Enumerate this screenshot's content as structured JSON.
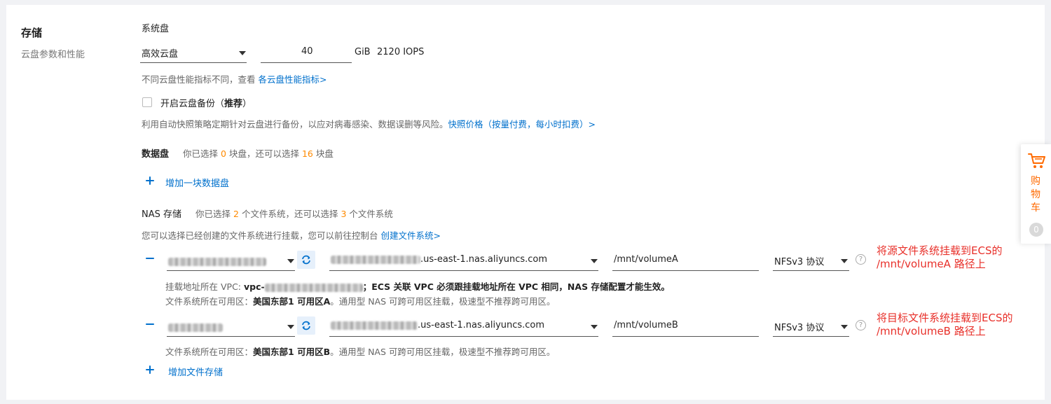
{
  "section": {
    "title": "存储",
    "subtitle": "云盘参数和性能"
  },
  "system_disk": {
    "label": "系统盘",
    "type_value": "高效云盘",
    "size_value": "40",
    "unit": "GiB",
    "iops": "2120 IOPS",
    "perf_note": "不同云盘性能指标不同，查看",
    "perf_link": "各云盘性能指标>",
    "backup_label": "开启云盘备份（",
    "backup_bold": "推荐",
    "backup_close": "）",
    "backup_desc": "利用自动快照策略定期针对云盘进行备份，以应对病毒感染、数据误删等风险。",
    "snapshot_link": "快照价格（按量付费，每小时扣费）>"
  },
  "data_disk": {
    "label": "数据盘",
    "status_pre": "你已选择",
    "selected": "0",
    "status_mid": "块盘，还可以选择",
    "remaining": "16",
    "status_post": "块盘",
    "add_label": "增加一块数据盘"
  },
  "nas": {
    "label": "NAS 存储",
    "status_pre": "你已选择",
    "selected": "2",
    "status_mid": "个文件系统，还可以选择",
    "remaining": "3",
    "status_post": "个文件系统",
    "note": "您可以选择已经创建的文件系统进行挂载，您可以前往控制台",
    "create_link": "创建文件系统>",
    "add_label": "增加文件存储",
    "mounts": [
      {
        "mount_suffix": ".us-east-1.nas.aliyuncs.com",
        "path": "/mnt/volumeA",
        "protocol": "NFSv3 协议",
        "vpc_label": "挂载地址所在 VPC:",
        "vpc_prefix": "vpc-",
        "vpc_note": "；ECS 关联 VPC 必须跟挂载地址所在 VPC 相同，NAS 存储配置才能生效。",
        "zone_label": "文件系统所在可用区：",
        "zone_value": "美国东部1 可用区A",
        "zone_note": "。通用型 NAS 可跨可用区挂载，极速型不推荐跨可用区。",
        "annotation_line1": "将源文件系统挂载到ECS的",
        "annotation_line2": "/mnt/volumeA 路径上"
      },
      {
        "mount_suffix": ".us-east-1.nas.aliyuncs.com",
        "path": "/mnt/volumeB",
        "protocol": "NFSv3 协议",
        "zone_label": "文件系统所在可用区：",
        "zone_value": "美国东部1 可用区B",
        "zone_note": "。通用型 NAS 可跨可用区挂载，极速型不推荐跨可用区。",
        "annotation_line1": "将目标文件系统挂载到ECS的",
        "annotation_line2": "/mnt/volumeB 路径上"
      }
    ]
  },
  "cart": {
    "label": "购物车",
    "count": "0"
  },
  "colors": {
    "link": "#0070cc",
    "orange": "#ff8a00",
    "annotation": "#e8302a",
    "cart": "#ff6a00"
  }
}
